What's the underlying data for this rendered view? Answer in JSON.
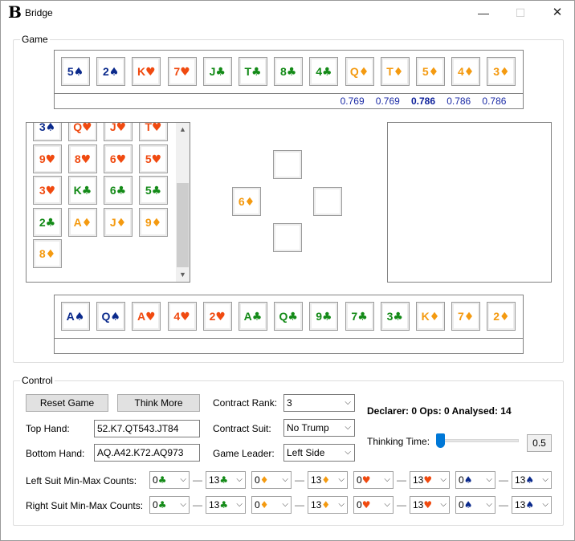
{
  "window": {
    "icon_glyph": "B",
    "title": "Bridge",
    "min_glyph": "—",
    "max_glyph": "☐",
    "close_glyph": "✕"
  },
  "suit_colors": {
    "spade": "#0b2a8c",
    "heart": "#f04a10",
    "club": "#138a17",
    "diamond": "#f49a10"
  },
  "game": {
    "label": "Game",
    "top_hand": [
      {
        "rank": "5",
        "suit": "♠"
      },
      {
        "rank": "2",
        "suit": "♠"
      },
      {
        "rank": "K",
        "suit": "♥"
      },
      {
        "rank": "7",
        "suit": "♥"
      },
      {
        "rank": "J",
        "suit": "♣"
      },
      {
        "rank": "T",
        "suit": "♣"
      },
      {
        "rank": "8",
        "suit": "♣"
      },
      {
        "rank": "4",
        "suit": "♣"
      },
      {
        "rank": "Q",
        "suit": "♦"
      },
      {
        "rank": "T",
        "suit": "♦"
      },
      {
        "rank": "5",
        "suit": "♦"
      },
      {
        "rank": "4",
        "suit": "♦"
      },
      {
        "rank": "3",
        "suit": "♦"
      }
    ],
    "top_scores": [
      "0.769",
      "0.769",
      "0.786",
      "0.786",
      "0.786"
    ],
    "left_hand": [
      {
        "rank": "3",
        "suit": "♠"
      },
      {
        "rank": "Q",
        "suit": "♥"
      },
      {
        "rank": "J",
        "suit": "♥"
      },
      {
        "rank": "T",
        "suit": "♥"
      },
      {
        "rank": "9",
        "suit": "♥"
      },
      {
        "rank": "8",
        "suit": "♥"
      },
      {
        "rank": "6",
        "suit": "♥"
      },
      {
        "rank": "5",
        "suit": "♥"
      },
      {
        "rank": "3",
        "suit": "♥"
      },
      {
        "rank": "K",
        "suit": "♣"
      },
      {
        "rank": "6",
        "suit": "♣"
      },
      {
        "rank": "5",
        "suit": "♣"
      },
      {
        "rank": "2",
        "suit": "♣"
      },
      {
        "rank": "A",
        "suit": "♦"
      },
      {
        "rank": "J",
        "suit": "♦"
      },
      {
        "rank": "9",
        "suit": "♦"
      },
      {
        "rank": "8",
        "suit": "♦"
      }
    ],
    "trick": {
      "north": {
        "rank": "",
        "suit": ""
      },
      "west": {
        "rank": "6",
        "suit": "♦"
      },
      "east": {
        "rank": "",
        "suit": ""
      },
      "south": {
        "rank": "",
        "suit": ""
      }
    },
    "bottom_hand": [
      {
        "rank": "A",
        "suit": "♠"
      },
      {
        "rank": "Q",
        "suit": "♠"
      },
      {
        "rank": "A",
        "suit": "♥"
      },
      {
        "rank": "4",
        "suit": "♥"
      },
      {
        "rank": "2",
        "suit": "♥"
      },
      {
        "rank": "A",
        "suit": "♣"
      },
      {
        "rank": "Q",
        "suit": "♣"
      },
      {
        "rank": "9",
        "suit": "♣"
      },
      {
        "rank": "7",
        "suit": "♣"
      },
      {
        "rank": "3",
        "suit": "♣"
      },
      {
        "rank": "K",
        "suit": "♦"
      },
      {
        "rank": "7",
        "suit": "♦"
      },
      {
        "rank": "2",
        "suit": "♦"
      }
    ],
    "scrollbar": {
      "up_glyph": "▲",
      "down_glyph": "▼"
    }
  },
  "control": {
    "label": "Control",
    "reset_label": "Reset Game",
    "think_label": "Think More",
    "top_hand_label": "Top Hand:",
    "top_hand_value": "52.K7.QT543.JT84",
    "bottom_hand_label": "Bottom Hand:",
    "bottom_hand_value": "AQ.A42.K72.AQ973",
    "contract_rank_label": "Contract Rank:",
    "contract_rank_value": "3",
    "contract_suit_label": "Contract Suit:",
    "contract_suit_value": "No Trump",
    "game_leader_label": "Game Leader:",
    "game_leader_value": "Left Side",
    "status_text": "Declarer: 0 Ops: 0 Analysed: 14",
    "thinking_time_label": "Thinking Time:",
    "thinking_time_value": "0.5",
    "thinking_time_level": 0.0,
    "dropdown_arrow": "⌵",
    "dash": "—",
    "left_counts_label": "Left Suit Min-Max Counts:",
    "right_counts_label": "Right Suit Min-Max Counts:",
    "left_counts": [
      {
        "value": "0",
        "suit": "♣"
      },
      {
        "value": "13",
        "suit": "♣"
      },
      {
        "value": "0",
        "suit": "♦"
      },
      {
        "value": "13",
        "suit": "♦"
      },
      {
        "value": "0",
        "suit": "♥"
      },
      {
        "value": "13",
        "suit": "♥"
      },
      {
        "value": "0",
        "suit": "♠"
      },
      {
        "value": "13",
        "suit": "♠"
      }
    ],
    "right_counts": [
      {
        "value": "0",
        "suit": "♣"
      },
      {
        "value": "13",
        "suit": "♣"
      },
      {
        "value": "0",
        "suit": "♦"
      },
      {
        "value": "13",
        "suit": "♦"
      },
      {
        "value": "0",
        "suit": "♥"
      },
      {
        "value": "13",
        "suit": "♥"
      },
      {
        "value": "0",
        "suit": "♠"
      },
      {
        "value": "13",
        "suit": "♠"
      }
    ]
  }
}
